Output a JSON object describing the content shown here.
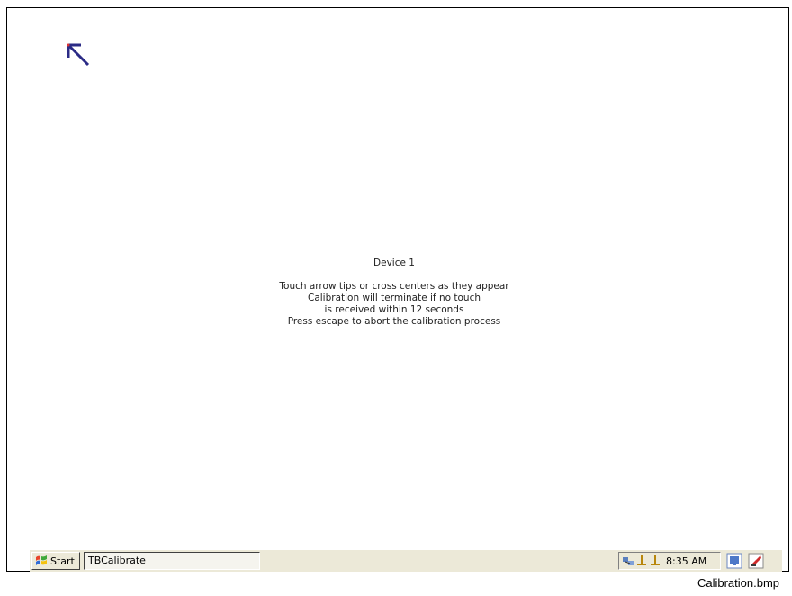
{
  "screen": {
    "device_label": "Device 1",
    "instructions": [
      "Touch arrow tips or cross centers as they appear",
      "Calibration will terminate if no touch",
      "is received within 12 seconds",
      "Press escape to abort the calibration process"
    ],
    "target_icon": "calibration-arrow-top-left",
    "arrow_color": "#2b2b86"
  },
  "taskbar": {
    "start_label": "Start",
    "task_label": "TBCalibrate",
    "clock": "8:35 AM",
    "tray_icons": [
      "network-icon",
      "usb-icon",
      "usb-icon"
    ],
    "right_icons": [
      "desktop-icon",
      "input-panel-icon"
    ],
    "background": "#ece9d8"
  },
  "caption": "Calibration.bmp"
}
